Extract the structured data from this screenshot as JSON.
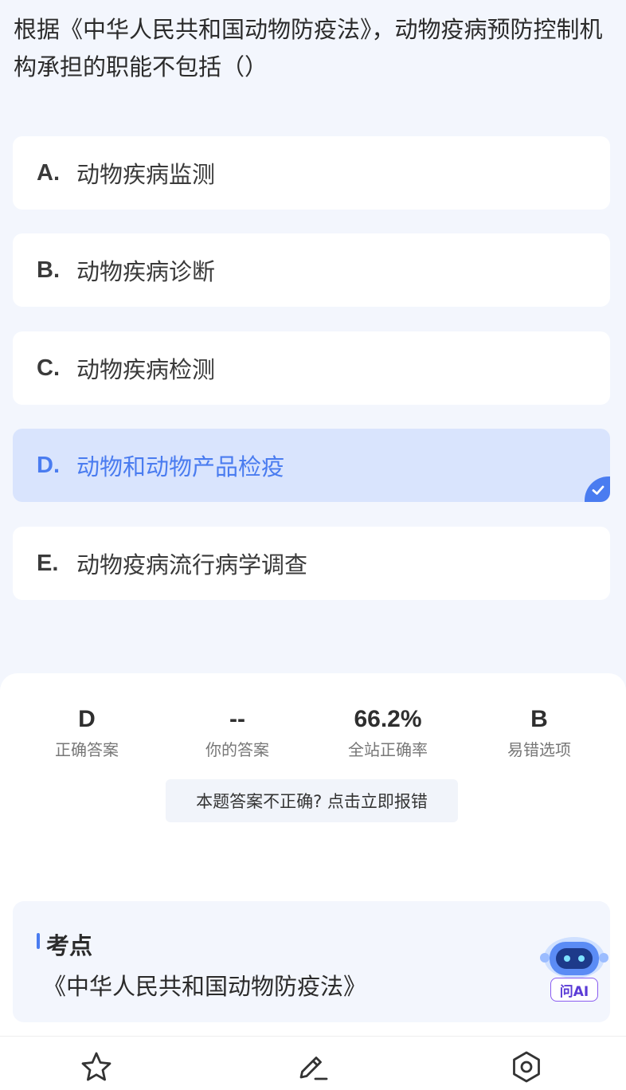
{
  "question": {
    "text": "根据《中华人民共和国动物防疫法》，动物疫病预防控制机构承担的职能不包括（）"
  },
  "options": [
    {
      "letter": "A.",
      "text": "动物疾病监测",
      "selected": false
    },
    {
      "letter": "B.",
      "text": "动物疾病诊断",
      "selected": false
    },
    {
      "letter": "C.",
      "text": "动物疾病检测",
      "selected": false
    },
    {
      "letter": "D.",
      "text": "动物和动物产品检疫",
      "selected": true
    },
    {
      "letter": "E.",
      "text": "动物疫病流行病学调查",
      "selected": false
    }
  ],
  "stats": {
    "correct_answer": {
      "value": "D",
      "label": "正确答案"
    },
    "your_answer": {
      "value": "--",
      "label": "你的答案"
    },
    "site_accuracy": {
      "value": "66.2%",
      "label": "全站正确率"
    },
    "common_mistake": {
      "value": "B",
      "label": "易错选项"
    }
  },
  "report_button": "本题答案不正确? 点击立即报错",
  "exam_point": {
    "title": "考点",
    "text": "《中华人民共和国动物防疫法》"
  },
  "ai_assistant": {
    "label": "问AI",
    "icon": "robot-icon"
  },
  "bottom_tabs": [
    {
      "icon": "star-icon"
    },
    {
      "icon": "pencil-icon"
    },
    {
      "icon": "settings-icon"
    }
  ],
  "colors": {
    "accent": "#4a7cf0",
    "selected_bg": "#d9e4fd",
    "page_bg": "#f3f6fd"
  }
}
